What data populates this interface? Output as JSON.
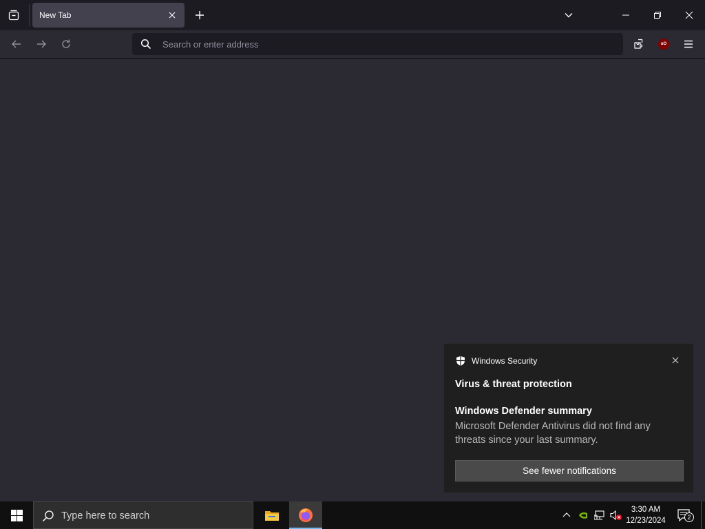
{
  "browser": {
    "tab": {
      "title": "New Tab"
    },
    "urlbar": {
      "placeholder": "Search or enter address"
    },
    "extensions": {
      "ublock_badge": "uO"
    }
  },
  "notification": {
    "app_name": "Windows Security",
    "title": "Virus & threat protection",
    "heading": "Windows Defender summary",
    "body": "Microsoft Defender Antivirus did not find any threats since your last summary.",
    "button_label": "See fewer notifications"
  },
  "taskbar": {
    "search_placeholder": "Type here to search",
    "apps": [
      {
        "name": "File Explorer",
        "icon": "folder-icon",
        "active": false
      },
      {
        "name": "Firefox",
        "icon": "firefox-icon",
        "active": true
      }
    ],
    "clock": {
      "time": "3:30 AM",
      "date": "12/23/2024"
    },
    "action_center_count": "2"
  },
  "colors": {
    "browser_bg": "#2b2a33",
    "tabstrip_bg": "#1c1b22",
    "active_tab_bg": "#42414d",
    "toast_bg": "#1f1f1f",
    "taskbar_bg": "#101010",
    "active_underline": "#76b9ed",
    "ublock_red": "#800000"
  }
}
